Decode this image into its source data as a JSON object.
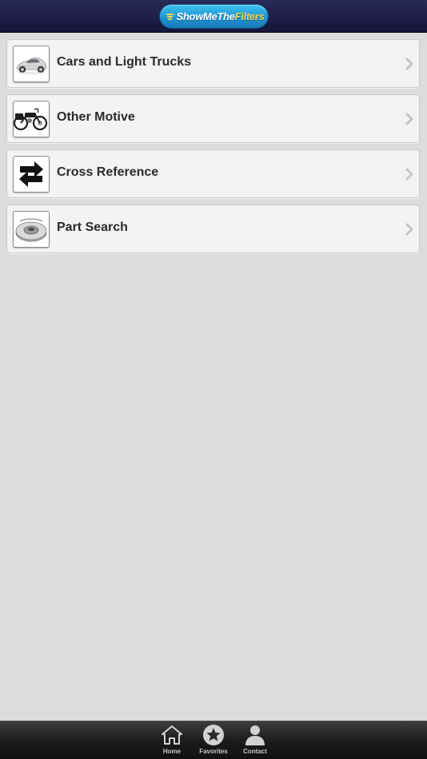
{
  "header": {
    "logo_text_prefix": "ShowMeThe",
    "logo_text_accent": "Filters"
  },
  "menu": {
    "items": [
      {
        "label": "Cars and Light Trucks",
        "icon": "car-icon"
      },
      {
        "label": "Other Motive",
        "icon": "motorcycle-icon"
      },
      {
        "label": "Cross Reference",
        "icon": "swap-arrows-icon"
      },
      {
        "label": "Part Search",
        "icon": "brake-disc-icon"
      }
    ],
    "chevron_icon": "chevron-right-icon"
  },
  "tabbar": {
    "tabs": [
      {
        "label": "Home",
        "icon": "home-icon"
      },
      {
        "label": "Favorites",
        "icon": "star-icon"
      },
      {
        "label": "Contact",
        "icon": "person-icon"
      }
    ]
  },
  "colors": {
    "header_bg": "#1b1b45",
    "logo_blue": "#1f95d4",
    "logo_accent": "#f4d64a",
    "page_bg": "#dddcdd",
    "item_bg": "#f3f3f3",
    "label_text": "#2b2b2b",
    "tabbar_bg": "#1c1c1c"
  }
}
